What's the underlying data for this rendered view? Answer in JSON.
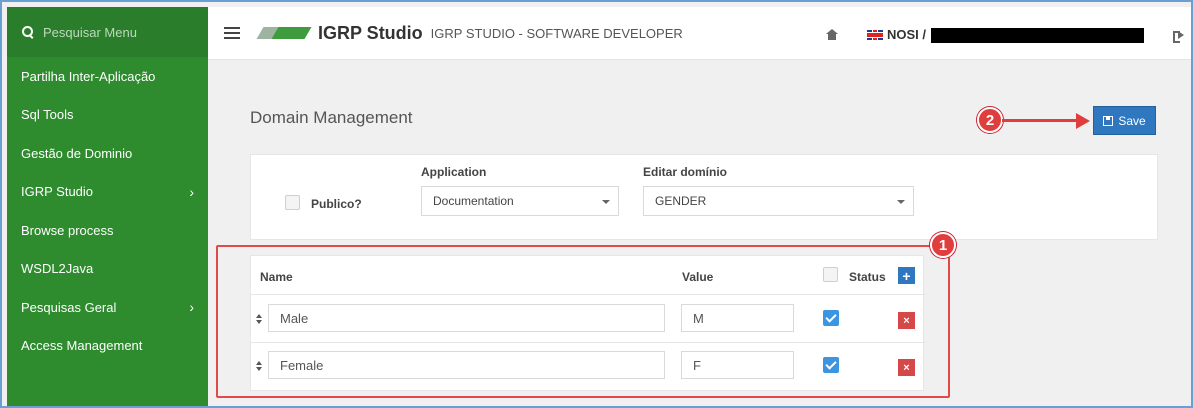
{
  "sidebar": {
    "search_placeholder": "Pesquisar Menu",
    "items": [
      {
        "label": "Partilha Inter-Aplicação",
        "has_submenu": false
      },
      {
        "label": "Sql Tools",
        "has_submenu": false
      },
      {
        "label": "Gestão de Dominio",
        "has_submenu": false
      },
      {
        "label": "IGRP Studio",
        "has_submenu": true
      },
      {
        "label": "Browse process",
        "has_submenu": false
      },
      {
        "label": "WSDL2Java",
        "has_submenu": false
      },
      {
        "label": "Pesquisas Geral",
        "has_submenu": true
      },
      {
        "label": "Access Management",
        "has_submenu": false
      }
    ],
    "submenu_glyph": "›"
  },
  "header": {
    "brand": "IGRP Studio",
    "subtitle": "IGRP STUDIO - SOFTWARE DEVELOPER",
    "user": "NOSI /"
  },
  "main": {
    "title": "Domain Management",
    "save_label": "Save",
    "form": {
      "publico_label": "Publico?",
      "application_label": "Application",
      "application_value": "Documentation",
      "editar_label": "Editar domínio",
      "editar_value": "GENDER"
    },
    "table": {
      "headers": {
        "name": "Name",
        "value": "Value",
        "status": "Status"
      },
      "add_glyph": "+",
      "delete_glyph": "×",
      "rows": [
        {
          "name": "Male",
          "value": "M",
          "status": true
        },
        {
          "name": "Female",
          "value": "F",
          "status": true
        }
      ]
    }
  },
  "annotations": {
    "badge1": "1",
    "badge2": "2"
  },
  "colors": {
    "sidebar": "#2e8b2e",
    "primary": "#2f78c0",
    "danger": "#d64848",
    "annotation": "#e03d3d"
  }
}
